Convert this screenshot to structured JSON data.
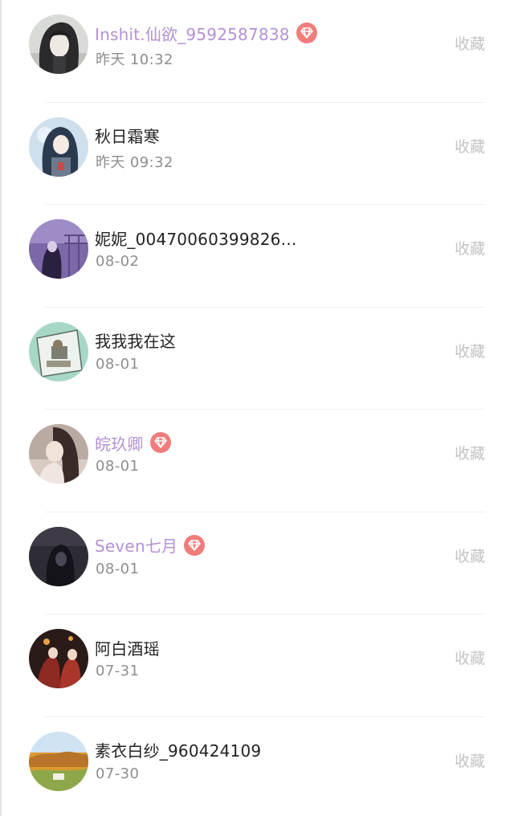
{
  "colors": {
    "vip_name": "#b491d6",
    "vip_badge": "#f07c7c",
    "time_text": "#8e8e8e",
    "collect_text": "#c4c4c4"
  },
  "items": [
    {
      "name": "Inshit.仙欲_9592587838",
      "time": "昨天 10:32",
      "vip": true,
      "action": "收藏",
      "avatar_icon": "avatar-dark-hair-girl"
    },
    {
      "name": "秋日霜寒",
      "time": "昨天 09:32",
      "vip": false,
      "action": "收藏",
      "avatar_icon": "avatar-anime-girl"
    },
    {
      "name": "妮妮_00470060399826…",
      "time": "08-02",
      "vip": false,
      "action": "收藏",
      "avatar_icon": "avatar-purple-night"
    },
    {
      "name": "我我我在这",
      "time": "08-01",
      "vip": false,
      "action": "收藏",
      "avatar_icon": "avatar-room-drawing"
    },
    {
      "name": "皖玖卿",
      "time": "08-01",
      "vip": true,
      "action": "收藏",
      "avatar_icon": "avatar-long-hair-girl"
    },
    {
      "name": "Seven七月",
      "time": "08-01",
      "vip": true,
      "action": "收藏",
      "avatar_icon": "avatar-dark-hood"
    },
    {
      "name": "阿白酒瑶",
      "time": "07-31",
      "vip": false,
      "action": "收藏",
      "avatar_icon": "avatar-red-costume"
    },
    {
      "name": "素衣白纱_960424109",
      "time": "07-30",
      "vip": false,
      "action": "收藏",
      "avatar_icon": "avatar-autumn-landscape"
    }
  ]
}
